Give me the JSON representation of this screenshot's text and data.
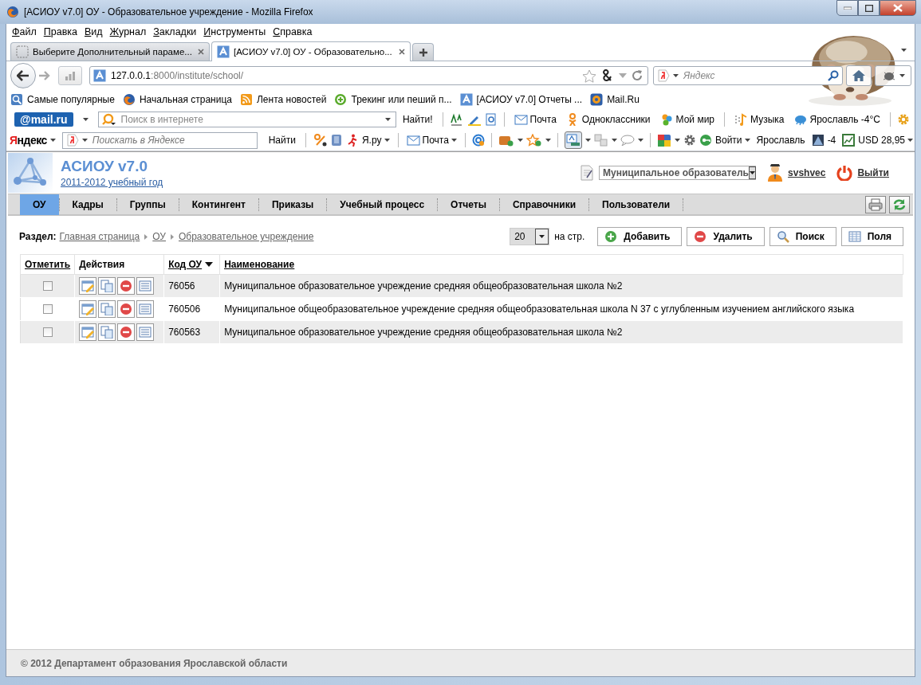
{
  "window": {
    "title": "[АСИОУ v7.0] ОУ - Образовательное учреждение - Mozilla Firefox"
  },
  "menu": [
    "Файл",
    "Правка",
    "Вид",
    "Журнал",
    "Закладки",
    "Инструменты",
    "Справка"
  ],
  "tabs": [
    {
      "label": "Выберите Дополнительный параме...",
      "selected": false
    },
    {
      "label": "[АСИОУ v7.0] ОУ - Образовательно...",
      "selected": true
    }
  ],
  "address": {
    "host": "127.0.0.1",
    "path": ":8000/institute/school/"
  },
  "search": {
    "placeholder": "Яндекс"
  },
  "bookmarks": [
    {
      "kind": "popular",
      "label": "Самые популярные"
    },
    {
      "kind": "firefox",
      "label": "Начальная страница"
    },
    {
      "kind": "rss",
      "label": "Лента новостей"
    },
    {
      "kind": "plus",
      "label": "Трекинг или пеший п..."
    },
    {
      "kind": "site",
      "label": "[АСИОУ v7.0] Отчеты ..."
    },
    {
      "kind": "at",
      "label": "Mail.Ru"
    }
  ],
  "mailru_bar": {
    "logo": "@mail.ru",
    "placeholder": "Поиск в интернете",
    "find": "Найти!",
    "items": [
      {
        "kind": "mail",
        "label": "Почта"
      },
      {
        "kind": "classmates",
        "label": "Одноклассники"
      },
      {
        "kind": "world",
        "label": "Мой мир"
      },
      {
        "kind": "music",
        "label": "Музыка"
      },
      {
        "kind": "weather",
        "label": "Ярославль -4°C"
      }
    ]
  },
  "yandex_bar": {
    "logo": "Яндекс",
    "placeholder": "Поискать в Яндексе",
    "find": "Найти",
    "items": [
      {
        "kind": "yaru",
        "label": "Я.ру"
      },
      {
        "kind": "mail",
        "label": "Почта"
      },
      {
        "kind": "login",
        "label": "Войти"
      },
      {
        "kind": "city",
        "label": "Ярославль"
      },
      {
        "kind": "temp",
        "label": "-4"
      },
      {
        "kind": "currency",
        "label": "USD 28,95"
      }
    ]
  },
  "app": {
    "title": "АСИОУ v7.0",
    "year": "2011-2012 учебный год",
    "organization": "Муниципальное образователь",
    "user": "svshvec",
    "logout": "Выйти"
  },
  "nav": [
    {
      "label": "ОУ",
      "selected": true
    },
    {
      "label": "Кадры",
      "selected": false
    },
    {
      "label": "Группы",
      "selected": false
    },
    {
      "label": "Контингент",
      "selected": false
    },
    {
      "label": "Приказы",
      "selected": false
    },
    {
      "label": "Учебный процесс",
      "selected": false
    },
    {
      "label": "Отчеты",
      "selected": false
    },
    {
      "label": "Справочники",
      "selected": false
    },
    {
      "label": "Пользователи",
      "selected": false
    }
  ],
  "breadcrumb": {
    "label": "Раздел:",
    "items": [
      "Главная страница",
      "ОУ",
      "Образовательное учреждение"
    ]
  },
  "paging": {
    "size": "20",
    "suffix": "на стр."
  },
  "actions": [
    {
      "kind": "add",
      "label": "Добавить"
    },
    {
      "kind": "delete",
      "label": "Удалить"
    },
    {
      "kind": "search",
      "label": "Поиск"
    },
    {
      "kind": "fields",
      "label": "Поля"
    }
  ],
  "table": {
    "columns": [
      {
        "label": "Отметить",
        "link": true
      },
      {
        "label": "Действия",
        "link": false
      },
      {
        "label": "Код ОУ",
        "link": true,
        "sort_descending": true
      },
      {
        "label": "Наименование",
        "link": true
      }
    ],
    "rows": [
      {
        "checked": false,
        "code": "76056",
        "name": "Муниципальное образовательное учреждение средняя общеобразовательная школа №2"
      },
      {
        "checked": false,
        "code": "760506",
        "name": "Муниципальное общеобразовательное учреждение средняя общеобразовательная школа N 37 с углубленным изучением английского языка"
      },
      {
        "checked": false,
        "code": "760563",
        "name": "Муниципальное образовательное учреждение средняя общеобразовательная школа №2"
      }
    ]
  },
  "footer": "© 2012 Департамент образования Ярославской области"
}
